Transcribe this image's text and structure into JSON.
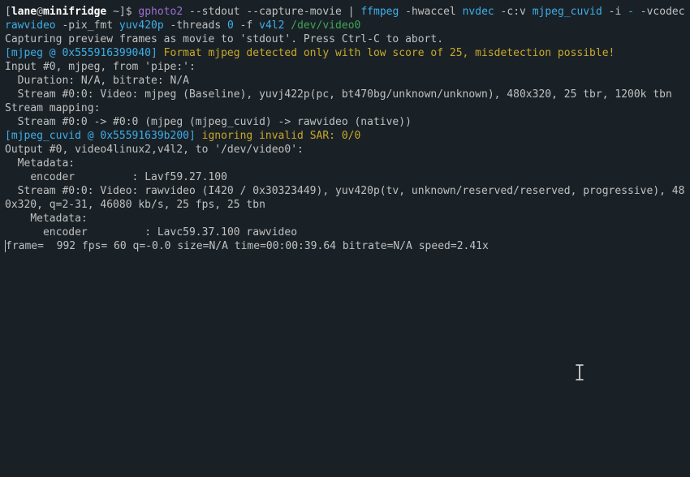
{
  "prompt": {
    "open": "[",
    "user": "lane",
    "at": "@",
    "host": "minifridge",
    "path": " ~",
    "close": "]$ "
  },
  "cmd": {
    "c1": "gphoto2",
    "a1": " --stdout --capture-movie ",
    "pipe": "| ",
    "c2": "ffmpeg",
    "k_hwaccel": " -hwaccel ",
    "v_hwaccel": "nvdec",
    "k_cv": " -c:v ",
    "v_cv": "mjpeg_cuvid",
    "k_i": " -i ",
    "v_i": "-",
    "k_vcodec": " -vcodec ",
    "v_vcodec": "rawvideo",
    "k_pixfmt": " -pix_fmt ",
    "v_pixfmt": "yuv420p",
    "k_threads": " -threads ",
    "v_threads": "0",
    "k_f": " -f ",
    "v_f": "v4l2",
    "sp": " ",
    "dev": "/dev/video0"
  },
  "out": {
    "l1": "Capturing preview frames as movie to 'stdout'. Press Ctrl-C to abort.",
    "tag1": "[mjpeg @ 0x555916399040]",
    "warn1": " Format mjpeg detected only with low score of 25, misdetection possible!",
    "l3": "Input #0, mjpeg, from 'pipe:':",
    "l4": "  Duration: N/A, bitrate: N/A",
    "l5": "  Stream #0:0: Video: mjpeg (Baseline), yuvj422p(pc, bt470bg/unknown/unknown), 480x320, 25 tbr, 1200k tbn",
    "l6": "Stream mapping:",
    "l7": "  Stream #0:0 -> #0:0 (mjpeg (mjpeg_cuvid) -> rawvideo (native))",
    "tag2": "[mjpeg_cuvid @ 0x55591639b200]",
    "warn2": " ignoring invalid SAR: 0/0",
    "l9": "Output #0, video4linux2,v4l2, to '/dev/video0':",
    "l10": "  Metadata:",
    "l11": "    encoder         : Lavf59.27.100",
    "l12": "  Stream #0:0: Video: rawvideo (I420 / 0x30323449), yuv420p(tv, unknown/reserved/reserved, progressive), 480x320, q=2-31, 46080 kb/s, 25 fps, 25 tbn",
    "l13": "    Metadata:",
    "l14": "      encoder         : Lavc59.37.100 rawvideo",
    "l15": "frame=  992 fps= 60 q=-0.0 size=N/A time=00:00:39.64 bitrate=N/A speed=2.41x"
  }
}
